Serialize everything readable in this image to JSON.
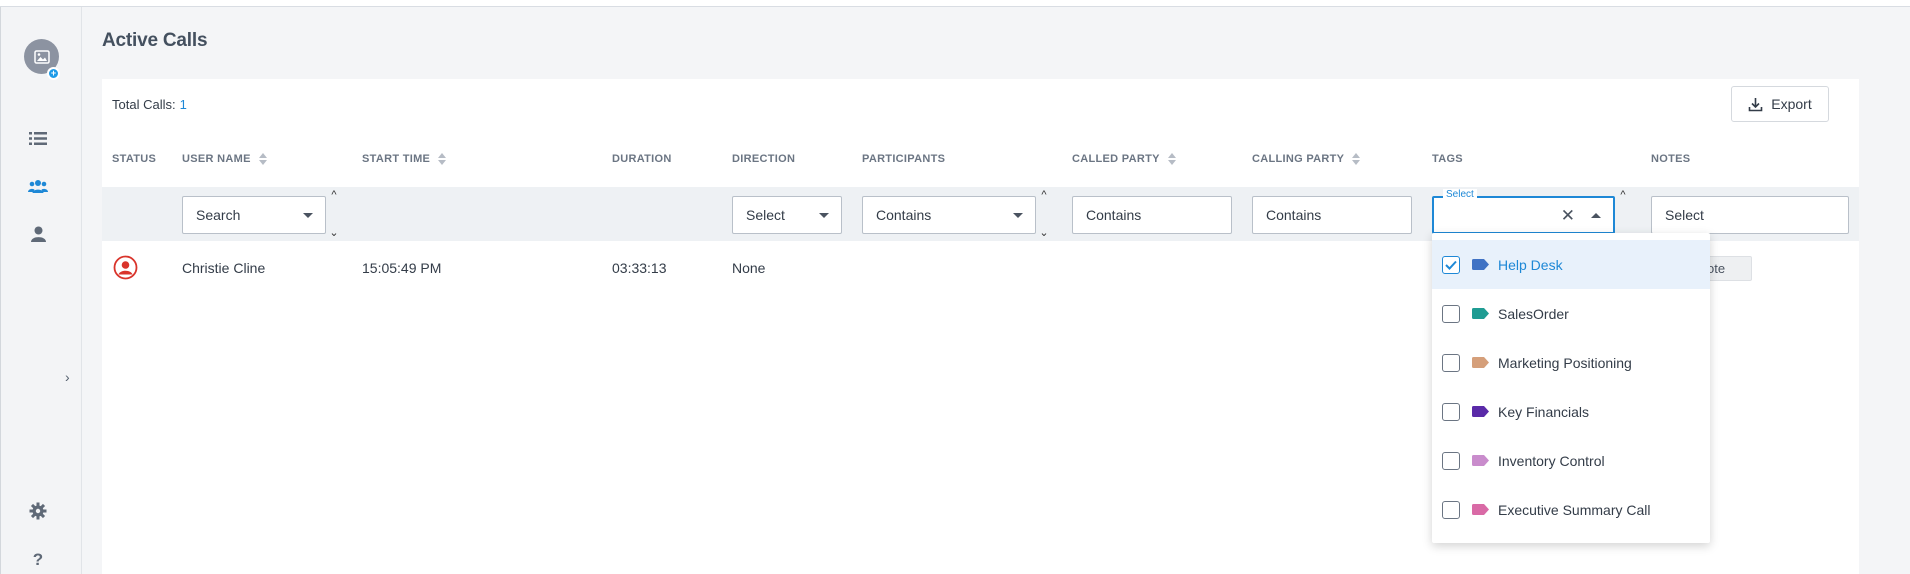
{
  "page": {
    "title": "Active Calls"
  },
  "summary": {
    "total_label": "Total Calls:",
    "total_count": "1"
  },
  "toolbar": {
    "export_label": "Export"
  },
  "columns": {
    "status": "STATUS",
    "user_name": "USER NAME",
    "start_time": "START TIME",
    "duration": "DURATION",
    "direction": "DIRECTION",
    "participants": "PARTICIPANTS",
    "called_party": "CALLED PARTY",
    "calling_party": "CALLING PARTY",
    "tags": "TAGS",
    "notes": "NOTES"
  },
  "filters": {
    "user_name": "Search",
    "direction": "Select",
    "participants": "Contains",
    "called_party": "Contains",
    "calling_party": "Contains",
    "tags_legend": "Select",
    "notes": "Select"
  },
  "rows": [
    {
      "user_name": "Christie Cline",
      "start_time": "15:05:49 PM",
      "duration": "03:33:13",
      "direction": "None",
      "note_button": "ote"
    }
  ],
  "tag_options": [
    {
      "label": "Help Desk",
      "color": "#3f72c4",
      "checked": true
    },
    {
      "label": "SalesOrder",
      "color": "#1f9c93",
      "checked": false
    },
    {
      "label": "Marketing Positioning",
      "color": "#d59f7a",
      "checked": false
    },
    {
      "label": "Key Financials",
      "color": "#5a2aa8",
      "checked": false
    },
    {
      "label": "Inventory Control",
      "color": "#c98ccc",
      "checked": false
    },
    {
      "label": "Executive Summary Call",
      "color": "#d96aa6",
      "checked": false
    }
  ],
  "sidebar": {
    "icons": [
      "avatar-image-icon",
      "list-icon",
      "team-icon",
      "person-icon",
      "gear-icon",
      "help-icon"
    ],
    "help_glyph": "?",
    "expand_glyph": "›"
  }
}
